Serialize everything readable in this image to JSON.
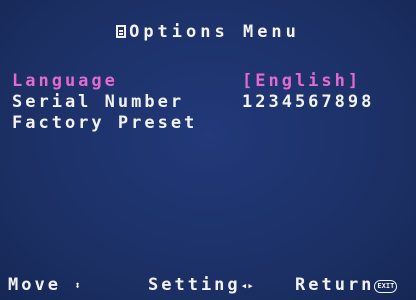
{
  "menu": {
    "title": "Options Menu",
    "title_icon": "document-icon",
    "items": [
      {
        "label": "Language",
        "value": "[English]",
        "selected": true
      },
      {
        "label": "Serial Number",
        "value": "1234567898",
        "selected": false
      },
      {
        "label": "Factory Preset",
        "value": "",
        "selected": false
      }
    ]
  },
  "footer": {
    "move_label": "Move",
    "move_icon": "up-down-arrow-icon",
    "setting_label": "Setting",
    "setting_icon": "left-right-arrow-icon",
    "return_label": "Return",
    "exit_icon_text": "EXIT"
  },
  "colors": {
    "background": "#1c3266",
    "text": "#f2f2f2",
    "highlight": "#e36bd0"
  }
}
